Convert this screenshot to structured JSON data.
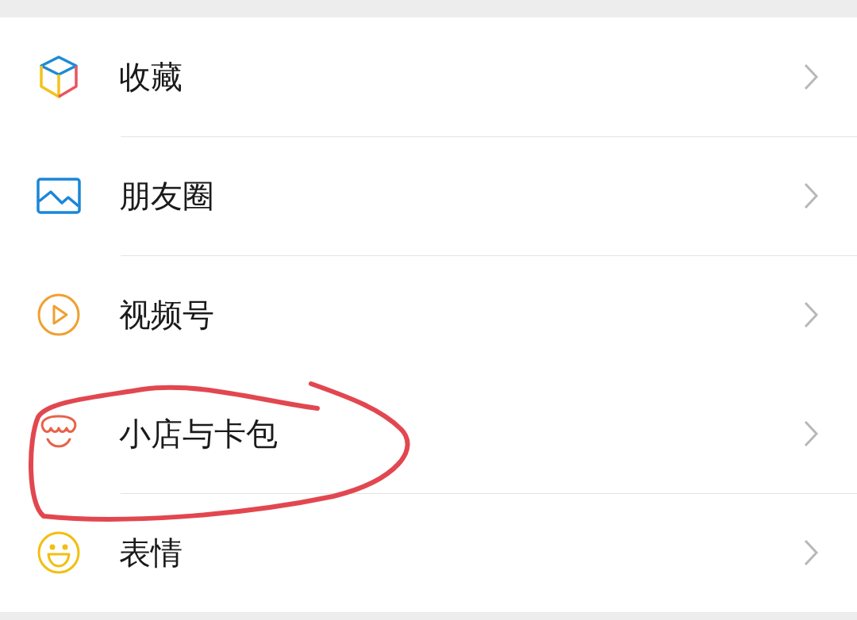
{
  "menu": {
    "items": [
      {
        "label": "收藏",
        "highlighted": false
      },
      {
        "label": "朋友圈",
        "highlighted": false
      },
      {
        "label": "视频号",
        "highlighted": false
      },
      {
        "label": "小店与卡包",
        "highlighted": true
      },
      {
        "label": "表情",
        "highlighted": false
      }
    ]
  }
}
